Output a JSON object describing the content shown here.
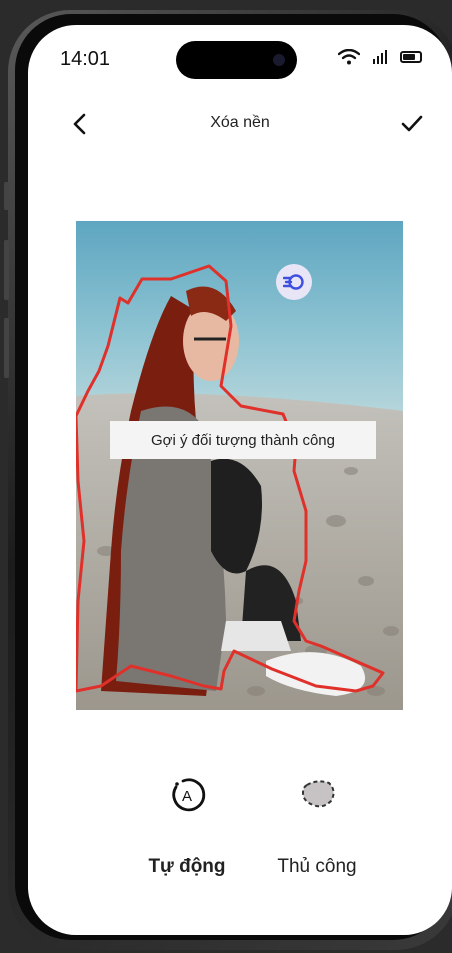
{
  "status_bar": {
    "time": "14:01",
    "icons": [
      "wifi-icon",
      "signal-icon",
      "battery-icon"
    ]
  },
  "header": {
    "title": "Xóa nền",
    "back_icon": "chevron-left-icon",
    "confirm_icon": "check-icon"
  },
  "editor": {
    "toast_text": "Gợi ý đối tượng thành công",
    "selection_color": "#e0302a",
    "fab_icon": "speed-icon"
  },
  "modes": [
    {
      "label": "Tự động",
      "icon": "auto-icon",
      "selected": true
    },
    {
      "label": "Thủ công",
      "icon": "lasso-icon",
      "selected": false
    }
  ],
  "colors": {
    "accent": "#e0302a",
    "fab_blue": "#3f4fe0"
  }
}
